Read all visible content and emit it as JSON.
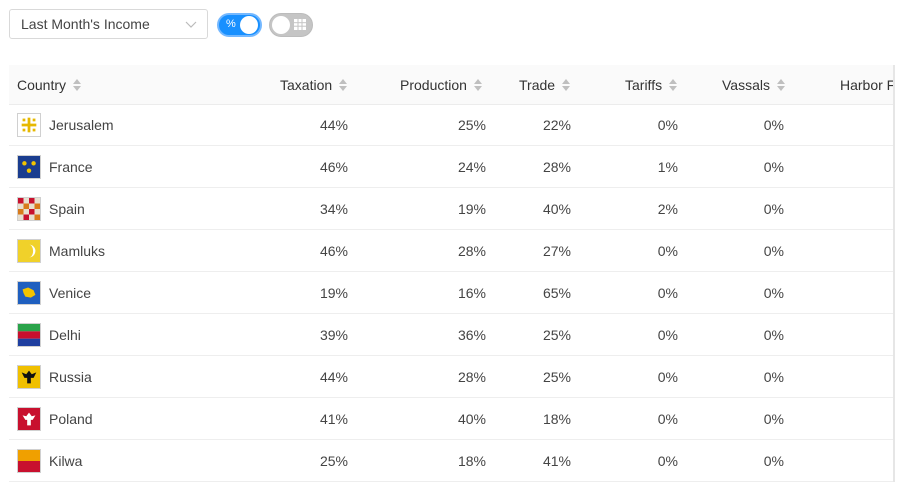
{
  "toolbar": {
    "select_value": "Last Month's Income",
    "percent_toggle_label": "%",
    "percent_toggle_on": true,
    "table_toggle_on": false
  },
  "table": {
    "columns": [
      "Country",
      "Taxation",
      "Production",
      "Trade",
      "Tariffs",
      "Vassals",
      "Harbor Fees"
    ],
    "rows": [
      {
        "country": "Jerusalem",
        "flag": "jerusalem-flag",
        "taxation": "44%",
        "production": "25%",
        "trade": "22%",
        "tariffs": "0%",
        "vassals": "0%"
      },
      {
        "country": "France",
        "flag": "france-flag",
        "taxation": "46%",
        "production": "24%",
        "trade": "28%",
        "tariffs": "1%",
        "vassals": "0%"
      },
      {
        "country": "Spain",
        "flag": "spain-flag",
        "taxation": "34%",
        "production": "19%",
        "trade": "40%",
        "tariffs": "2%",
        "vassals": "0%"
      },
      {
        "country": "Mamluks",
        "flag": "mamluks-flag",
        "taxation": "46%",
        "production": "28%",
        "trade": "27%",
        "tariffs": "0%",
        "vassals": "0%"
      },
      {
        "country": "Venice",
        "flag": "venice-flag",
        "taxation": "19%",
        "production": "16%",
        "trade": "65%",
        "tariffs": "0%",
        "vassals": "0%"
      },
      {
        "country": "Delhi",
        "flag": "delhi-flag",
        "taxation": "39%",
        "production": "36%",
        "trade": "25%",
        "tariffs": "0%",
        "vassals": "0%"
      },
      {
        "country": "Russia",
        "flag": "russia-flag",
        "taxation": "44%",
        "production": "28%",
        "trade": "25%",
        "tariffs": "0%",
        "vassals": "0%"
      },
      {
        "country": "Poland",
        "flag": "poland-flag",
        "taxation": "41%",
        "production": "40%",
        "trade": "18%",
        "tariffs": "0%",
        "vassals": "0%"
      },
      {
        "country": "Kilwa",
        "flag": "kilwa-flag",
        "taxation": "25%",
        "production": "18%",
        "trade": "41%",
        "tariffs": "0%",
        "vassals": "0%"
      }
    ]
  },
  "colors": {
    "accent": "#1890ff",
    "header_bg": "#fafafa",
    "row_border": "#eeeeee"
  }
}
